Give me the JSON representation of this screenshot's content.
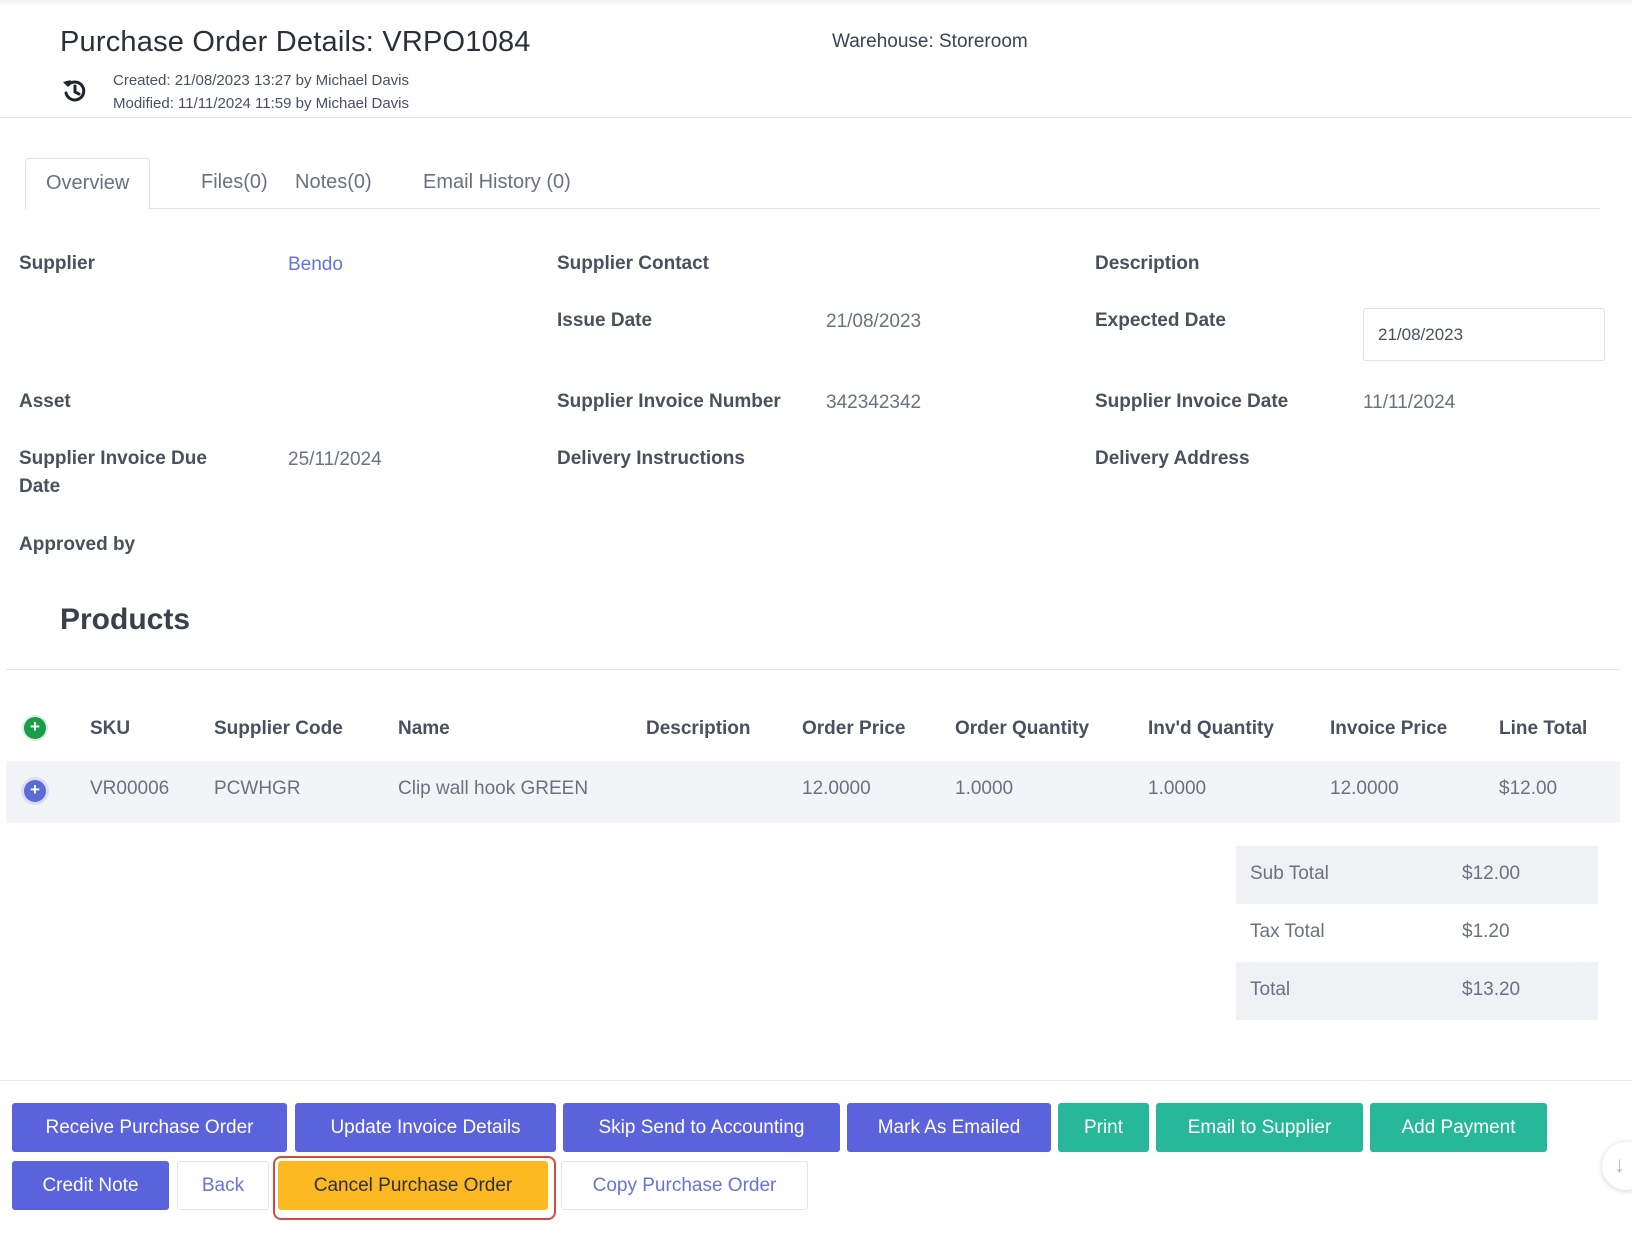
{
  "header": {
    "title": "Purchase Order Details: VRPO1084",
    "created": "Created: 21/08/2023 13:27 by Michael Davis",
    "modified": "Modified: 11/11/2024 11:59 by Michael Davis",
    "warehouse": "Warehouse: Storeroom",
    "history_icon": "history-icon"
  },
  "tabs": [
    {
      "label": "Overview",
      "active": true
    },
    {
      "label": "Files(0)"
    },
    {
      "label": "Notes(0)"
    },
    {
      "label": "Email History (0)"
    }
  ],
  "fields": {
    "supplier": {
      "label": "Supplier",
      "value": "Bendo"
    },
    "supplier_contact": {
      "label": "Supplier Contact",
      "value": ""
    },
    "description": {
      "label": "Description",
      "value": ""
    },
    "issue_date": {
      "label": "Issue Date",
      "value": "21/08/2023"
    },
    "expected_date": {
      "label": "Expected Date",
      "value": "21/08/2023"
    },
    "asset": {
      "label": "Asset",
      "value": ""
    },
    "supplier_invoice_number": {
      "label": "Supplier Invoice Number",
      "value": "342342342"
    },
    "supplier_invoice_date": {
      "label": "Supplier Invoice Date",
      "value": "11/11/2024"
    },
    "supplier_invoice_due_date": {
      "label_line1": "Supplier Invoice Due",
      "label_line2": "Date",
      "value": "25/11/2024"
    },
    "delivery_instructions": {
      "label": "Delivery Instructions",
      "value": ""
    },
    "delivery_address": {
      "label": "Delivery Address",
      "value": ""
    },
    "approved_by": {
      "label": "Approved by",
      "value": ""
    }
  },
  "products": {
    "title": "Products",
    "add_icon": "+",
    "columns": [
      "SKU",
      "Supplier Code",
      "Name",
      "Description",
      "Order Price",
      "Order Quantity",
      "Inv'd Quantity",
      "Invoice Price",
      "Line Total"
    ],
    "rows": [
      {
        "expand_icon": "+",
        "sku": "VR00006",
        "supplier_code": "PCWHGR",
        "name": "Clip wall hook GREEN",
        "description": "",
        "order_price": "12.0000",
        "order_quantity": "1.0000",
        "invd_quantity": "1.0000",
        "invoice_price": "12.0000",
        "line_total": "$12.00"
      }
    ]
  },
  "totals": {
    "sub_total": {
      "label": "Sub Total",
      "value": "$12.00"
    },
    "tax_total": {
      "label": "Tax Total",
      "value": "$1.20"
    },
    "total": {
      "label": "Total",
      "value": "$13.20"
    }
  },
  "actions": {
    "receive": "Receive Purchase Order",
    "update_invoice": "Update Invoice Details",
    "skip_accounting": "Skip Send to Accounting",
    "mark_emailed": "Mark As Emailed",
    "print": "Print",
    "email_supplier": "Email to Supplier",
    "add_payment": "Add Payment",
    "credit_note": "Credit Note",
    "back": "Back",
    "cancel_po": "Cancel Purchase Order",
    "copy_po": "Copy Purchase Order"
  },
  "colors": {
    "primary": "#5a63dc",
    "success": "#26b898",
    "warning": "#fdb921",
    "link": "#6674d9",
    "highlight": "#d24a3c"
  },
  "scroll_icon": "↓"
}
